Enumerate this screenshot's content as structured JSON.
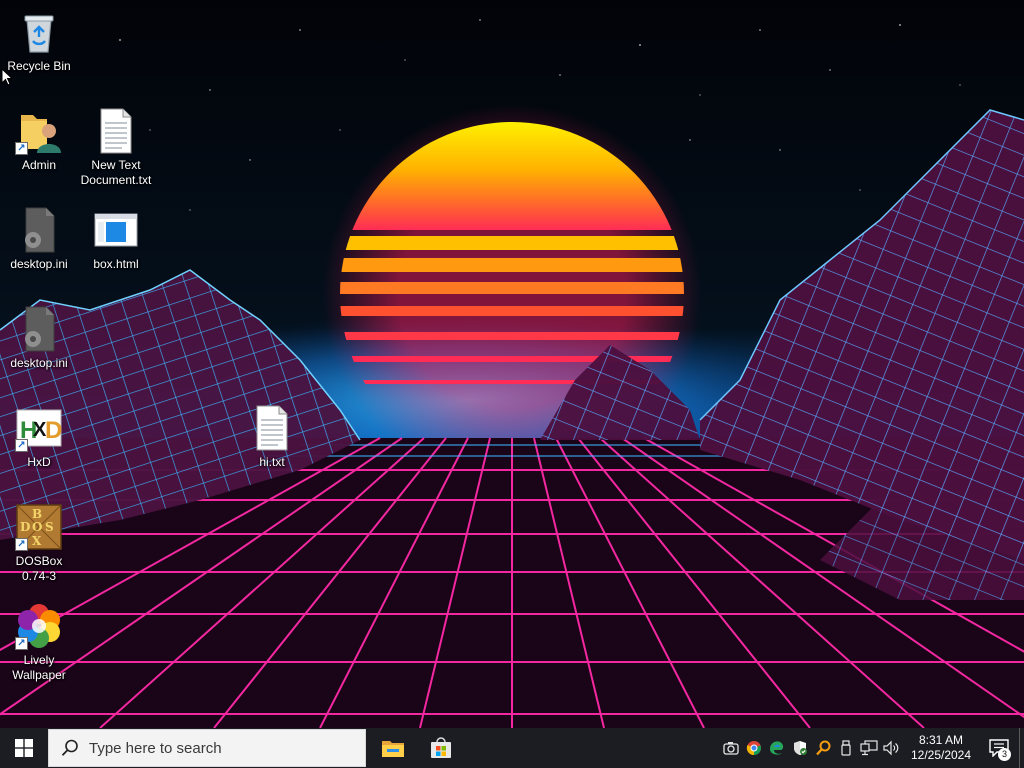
{
  "desktop": {
    "icons": [
      {
        "id": "recycle-bin",
        "label": "Recycle Bin",
        "shortcut": false
      },
      {
        "id": "admin",
        "label": "Admin",
        "shortcut": true
      },
      {
        "id": "new-text-document",
        "label": "New Text\nDocument.txt",
        "shortcut": false
      },
      {
        "id": "desktop-ini-1",
        "label": "desktop.ini",
        "shortcut": false
      },
      {
        "id": "box-html",
        "label": "box.html",
        "shortcut": false
      },
      {
        "id": "desktop-ini-2",
        "label": "desktop.ini",
        "shortcut": false
      },
      {
        "id": "hxd",
        "label": "HxD",
        "shortcut": true
      },
      {
        "id": "hi-txt",
        "label": "hi.txt",
        "shortcut": false
      },
      {
        "id": "dosbox",
        "label": "DOSBox\n0.74-3",
        "shortcut": true
      },
      {
        "id": "lively-wallpaper",
        "label": "Lively\nWallpaper",
        "shortcut": true
      }
    ]
  },
  "taskbar": {
    "search_placeholder": "Type here to search",
    "pinned_apps": [
      {
        "name": "file-explorer-icon",
        "open": false
      },
      {
        "name": "microsoft-store-icon",
        "open": false
      }
    ],
    "tray_icons": [
      "camera-icon",
      "chrome-icon",
      "edge-icon",
      "security-shield-icon",
      "search-tool-icon",
      "usb-icon",
      "network-icon",
      "volume-icon"
    ],
    "clock": {
      "time": "8:31 AM",
      "date": "12/25/2024"
    },
    "notification_count": "3"
  },
  "colors": {
    "taskbar_bg": "#1c1d22",
    "grid_pink": "#ff2aa8",
    "mountain_blue": "#3fb4ff",
    "sun_top": "#fff200",
    "sun_bottom": "#ff2d55"
  }
}
